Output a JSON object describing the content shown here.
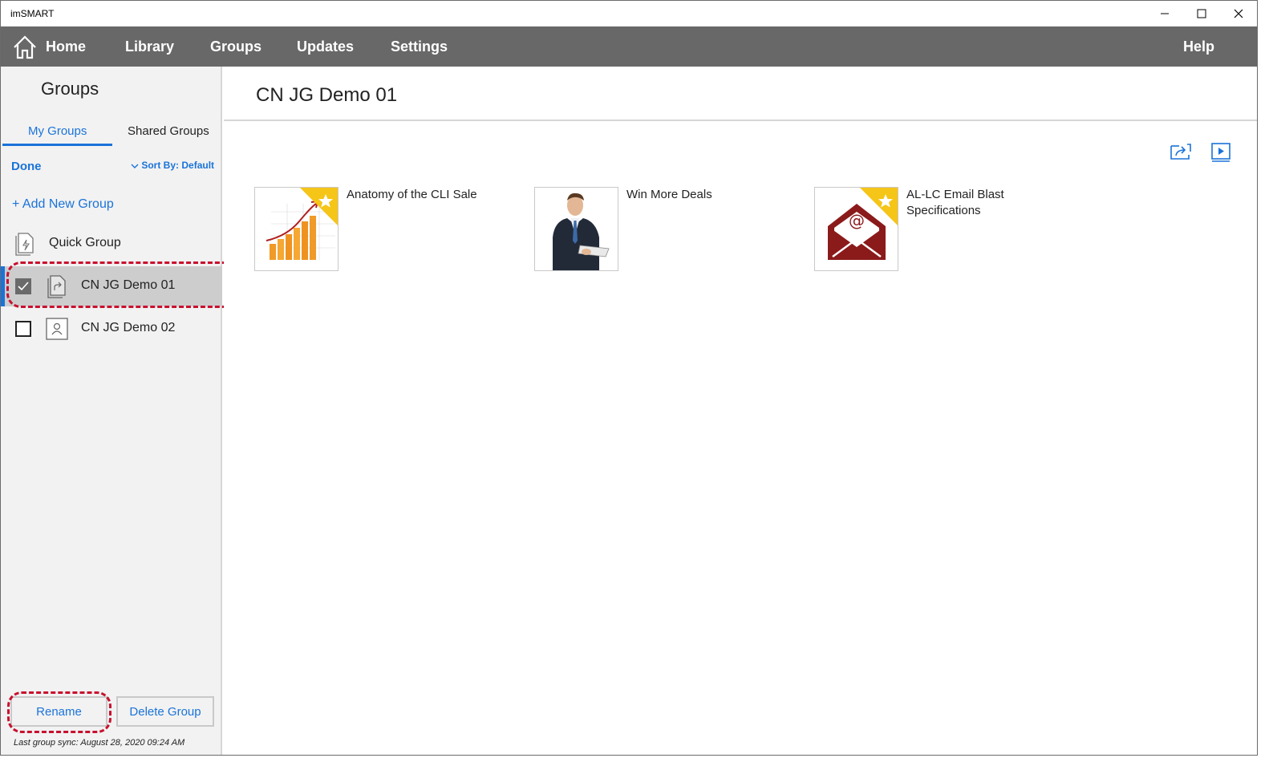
{
  "window": {
    "title": "imSMART"
  },
  "nav": {
    "home": "Home",
    "library": "Library",
    "groups": "Groups",
    "updates": "Updates",
    "settings": "Settings",
    "help": "Help"
  },
  "sidebar": {
    "title": "Groups",
    "tabs": {
      "my": "My Groups",
      "shared": "Shared Groups"
    },
    "done": "Done",
    "sort_label": "Sort By:",
    "sort_value": "Default",
    "add_group": "+ Add New Group",
    "groups": [
      {
        "name": "Quick Group",
        "checked": null
      },
      {
        "name": "CN JG Demo 01",
        "checked": true,
        "selected": true
      },
      {
        "name": "CN JG Demo 02",
        "checked": false
      }
    ],
    "rename": "Rename",
    "delete": "Delete Group",
    "sync": "Last group sync: August 28, 2020 09:24 AM"
  },
  "main": {
    "title": "CN JG Demo 01",
    "items": [
      {
        "title": "Anatomy of the CLI Sale",
        "thumb": "chart-thumbnail",
        "favorite": true
      },
      {
        "title": "Win More Deals",
        "thumb": "businessman-thumbnail",
        "favorite": false
      },
      {
        "title": "AL-LC Email Blast Specifications",
        "thumb": "email-thumbnail",
        "favorite": true
      }
    ]
  },
  "colors": {
    "accent": "#1a73d9",
    "nav_bg": "#686868",
    "highlight": "#c8102e",
    "favorite": "#f5c518",
    "email_red": "#8b1a1a"
  }
}
